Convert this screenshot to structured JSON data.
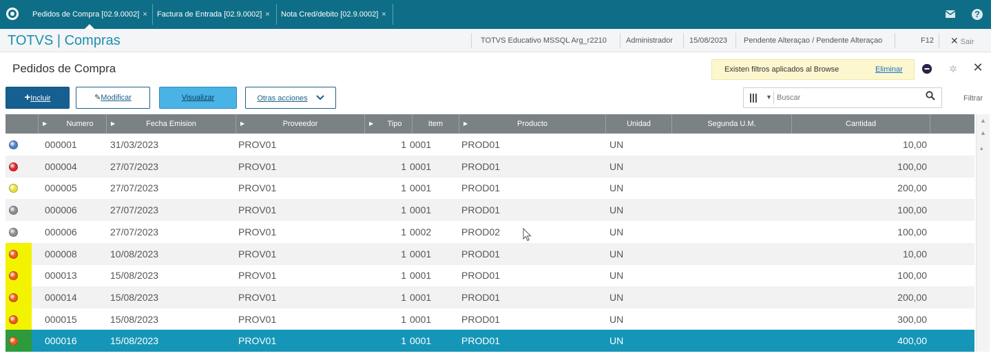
{
  "tabs": [
    {
      "label": "Pedidos de Compra [02.9.0002]",
      "active": true
    },
    {
      "label": "Factura de Entrada [02.9.0002]",
      "active": false
    },
    {
      "label": "Nota Cred/debito [02.9.0002]",
      "active": false
    }
  ],
  "tab_close": "×",
  "top_icons": {
    "mail": "mail-icon",
    "help": "help-icon",
    "help_glyph": "?"
  },
  "app": {
    "title": "TOTVS | Compras",
    "environment": "TOTVS Educativo MSSQL Arg_r2210",
    "user": "Administrador",
    "date": "15/08/2023",
    "status": "Pendente Alteraçao / Pendente Alteraçao",
    "shortcut": "F12",
    "exit_label": "Sair"
  },
  "page": {
    "title": "Pedidos de Compra",
    "filter_message": "Existen filtros aplicados al Browse",
    "filter_clear": "Eliminar"
  },
  "toolbar": {
    "add": "Incluir",
    "modify": "Modificar",
    "view": "Visualizar",
    "more": "Otras acciones",
    "search_placeholder": "Buscar",
    "filter": "Filtrar"
  },
  "grid": {
    "columns": [
      "Numero",
      "Fecha Emision",
      "Proveedor",
      "Tipo",
      "Item",
      "Producto",
      "Unidad",
      "Segunda U.M.",
      "Cantidad"
    ],
    "rows": [
      {
        "status": "#4f7fc6",
        "numero": "000001",
        "fecha": "31/03/2023",
        "proveedor": "PROV01",
        "tipo": "1",
        "item": "0001",
        "producto": "PROD01",
        "unidad": "UN",
        "segunda": "",
        "cantidad": "10,00",
        "highlight": false,
        "selected": false
      },
      {
        "status": "#e0242a",
        "numero": "000004",
        "fecha": "27/07/2023",
        "proveedor": "PROV01",
        "tipo": "1",
        "item": "0001",
        "producto": "PROD01",
        "unidad": "UN",
        "segunda": "",
        "cantidad": "100,00",
        "highlight": false,
        "selected": false
      },
      {
        "status": "#e7e23a",
        "numero": "000005",
        "fecha": "27/07/2023",
        "proveedor": "PROV01",
        "tipo": "1",
        "item": "0001",
        "producto": "PROD01",
        "unidad": "UN",
        "segunda": "",
        "cantidad": "200,00",
        "highlight": false,
        "selected": false
      },
      {
        "status": "#8c8c8c",
        "numero": "000006",
        "fecha": "27/07/2023",
        "proveedor": "PROV01",
        "tipo": "1",
        "item": "0001",
        "producto": "PROD01",
        "unidad": "UN",
        "segunda": "",
        "cantidad": "100,00",
        "highlight": false,
        "selected": false
      },
      {
        "status": "#8c8c8c",
        "numero": "000006",
        "fecha": "27/07/2023",
        "proveedor": "PROV01",
        "tipo": "1",
        "item": "0002",
        "producto": "PROD02",
        "unidad": "UN",
        "segunda": "",
        "cantidad": "100,00",
        "highlight": false,
        "selected": false
      },
      {
        "status": "#ee5a16",
        "numero": "000008",
        "fecha": "10/08/2023",
        "proveedor": "PROV01",
        "tipo": "1",
        "item": "0001",
        "producto": "PROD01",
        "unidad": "UN",
        "segunda": "",
        "cantidad": "10,00",
        "highlight": true,
        "selected": false
      },
      {
        "status": "#ee5a16",
        "numero": "000013",
        "fecha": "15/08/2023",
        "proveedor": "PROV01",
        "tipo": "1",
        "item": "0001",
        "producto": "PROD01",
        "unidad": "UN",
        "segunda": "",
        "cantidad": "100,00",
        "highlight": true,
        "selected": false
      },
      {
        "status": "#ee5a16",
        "numero": "000014",
        "fecha": "15/08/2023",
        "proveedor": "PROV01",
        "tipo": "1",
        "item": "0001",
        "producto": "PROD01",
        "unidad": "UN",
        "segunda": "",
        "cantidad": "200,00",
        "highlight": true,
        "selected": false
      },
      {
        "status": "#ee5a16",
        "numero": "000015",
        "fecha": "15/08/2023",
        "proveedor": "PROV01",
        "tipo": "1",
        "item": "0001",
        "producto": "PROD01",
        "unidad": "UN",
        "segunda": "",
        "cantidad": "300,00",
        "highlight": true,
        "selected": false
      },
      {
        "status": "#ee5a16",
        "numero": "000016",
        "fecha": "15/08/2023",
        "proveedor": "PROV01",
        "tipo": "1",
        "item": "0001",
        "producto": "PROD01",
        "unidad": "UN",
        "segunda": "",
        "cantidad": "400,00",
        "highlight": true,
        "selected": true
      }
    ]
  }
}
